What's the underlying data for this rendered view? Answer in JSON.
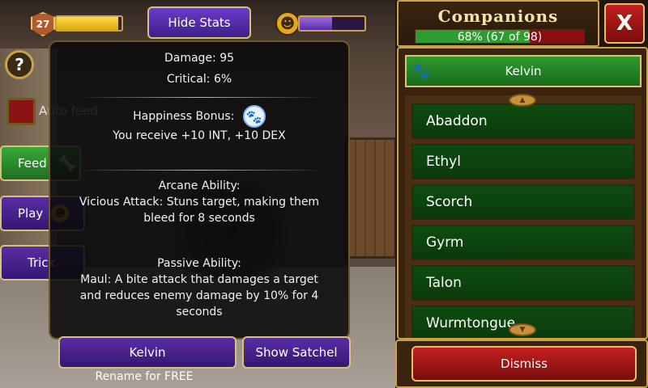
{
  "hud": {
    "level": "27",
    "xp_fraction": 0.95,
    "hide_stats_label": "Hide Stats",
    "happiness_fraction": 0.5,
    "help_label": "?"
  },
  "care": {
    "autofeed_label": "Auto feed",
    "feed_label": "Feed",
    "play_label": "Play",
    "trick_label": "Trick"
  },
  "stats": {
    "damage_label": "Damage:",
    "damage_value": "95",
    "critical_label": "Critical:",
    "critical_value": "6%",
    "happiness_title": "Happiness Bonus:",
    "happiness_text": "You receive +10 INT, +10 DEX",
    "arcane_title": "Arcane Ability:",
    "arcane_line1": "Vicious Attack: Stuns target, making them",
    "arcane_line2": "bleed for 8 seconds",
    "passive_title": "Passive Ability:",
    "passive_line1": "Maul: A bite attack that damages a target",
    "passive_line2": "and reduces enemy damage by 10% for 4",
    "passive_line3": "seconds"
  },
  "footer": {
    "name_label": "Kelvin",
    "satchel_label": "Show Satchel",
    "rename_label": "Rename for FREE"
  },
  "companions": {
    "title": "Companions",
    "progress_text": "68% (67 of 98)",
    "progress_fraction": 0.68,
    "close_label": "X",
    "selected": "Kelvin",
    "items": [
      "Abaddon",
      "Ethyl",
      "Scorch",
      "Gyrm",
      "Talon",
      "Wurmtongue"
    ],
    "dismiss_label": "Dismiss"
  },
  "colors": {
    "accent_gold": "#c9a24b",
    "button_purple": "#5a2ea6",
    "button_green": "#2f9a2f",
    "button_red": "#c42020"
  },
  "icons": {
    "happiness": "paw-icon",
    "feed": "bone-icon",
    "play": "happy-face-icon",
    "close": "close-icon"
  }
}
